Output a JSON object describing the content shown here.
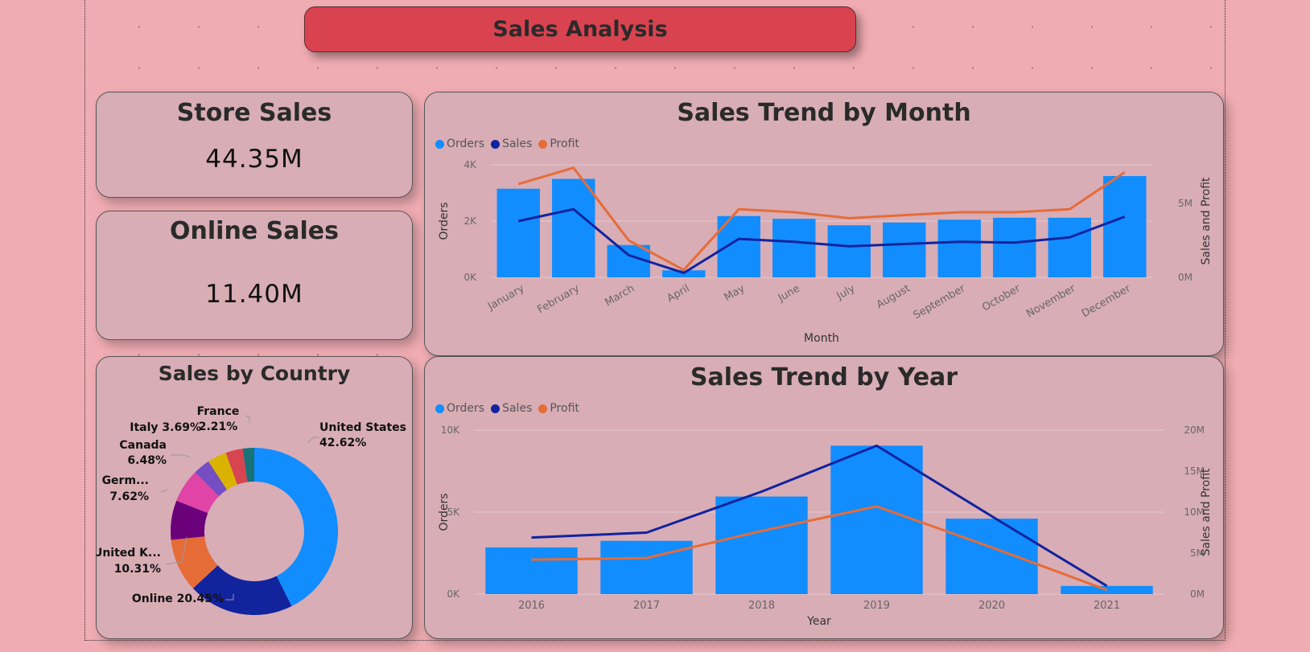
{
  "header": {
    "title": "Sales Analysis"
  },
  "kpis": {
    "store": {
      "title": "Store Sales",
      "value": "44.35M"
    },
    "online": {
      "title": "Online Sales",
      "value": "11.40M"
    }
  },
  "colors": {
    "orders": "#118dff",
    "sales": "#12239e",
    "profit": "#e66c37"
  },
  "legend": [
    "Orders",
    "Sales",
    "Profit"
  ],
  "chart_data": [
    {
      "id": "month",
      "type": "bar",
      "title": "Sales Trend by Month",
      "xlabel": "Month",
      "ylabel": "Orders",
      "y2label": "Sales and Profit",
      "categories": [
        "January",
        "February",
        "March",
        "April",
        "May",
        "June",
        "July",
        "August",
        "September",
        "October",
        "November",
        "December"
      ],
      "ylim": [
        0,
        4000
      ],
      "yticks": [
        0,
        2000,
        4000
      ],
      "ytick_labels": [
        "0K",
        "2K",
        "4K"
      ],
      "y2lim": [
        0,
        7600000
      ],
      "y2ticks": [
        0,
        5000000
      ],
      "y2tick_labels": [
        "0M",
        "5M"
      ],
      "series": [
        {
          "name": "Orders",
          "kind": "bar",
          "axis": "y",
          "values": [
            3150,
            3500,
            1150,
            250,
            2180,
            2080,
            1850,
            1950,
            2050,
            2120,
            2120,
            3600
          ]
        },
        {
          "name": "Sales",
          "kind": "line",
          "axis": "y2",
          "values": [
            3800000,
            4600000,
            1500000,
            300000,
            2600000,
            2400000,
            2100000,
            2250000,
            2400000,
            2350000,
            2700000,
            4100000
          ]
        },
        {
          "name": "Profit",
          "kind": "line",
          "axis": "y2",
          "values": [
            6300000,
            7400000,
            2500000,
            500000,
            4600000,
            4400000,
            4000000,
            4200000,
            4400000,
            4400000,
            4600000,
            7100000
          ]
        }
      ]
    },
    {
      "id": "year",
      "type": "bar",
      "title": "Sales Trend by Year",
      "xlabel": "Year",
      "ylabel": "Orders",
      "y2label": "Sales and Profit",
      "categories": [
        "2016",
        "2017",
        "2018",
        "2019",
        "2020",
        "2021"
      ],
      "ylim": [
        0,
        10000
      ],
      "yticks": [
        0,
        5000,
        10000
      ],
      "ytick_labels": [
        "0K",
        "5K",
        "10K"
      ],
      "y2lim": [
        0,
        20000000
      ],
      "y2ticks": [
        0,
        5000000,
        10000000,
        15000000,
        20000000
      ],
      "y2tick_labels": [
        "0M",
        "5M",
        "10M",
        "15M",
        "20M"
      ],
      "series": [
        {
          "name": "Orders",
          "kind": "bar",
          "axis": "y",
          "values": [
            2850,
            3250,
            5950,
            9050,
            4600,
            500
          ]
        },
        {
          "name": "Sales",
          "kind": "line",
          "axis": "y2",
          "values": [
            6900000,
            7500000,
            12500000,
            18100000,
            9500000,
            1000000
          ]
        },
        {
          "name": "Profit",
          "kind": "line",
          "axis": "y2",
          "values": [
            4200000,
            4400000,
            7700000,
            10700000,
            5700000,
            500000
          ]
        }
      ]
    },
    {
      "id": "country",
      "type": "pie",
      "title": "Sales by Country",
      "slices": [
        {
          "label": "United States",
          "pct_label": "42.62%",
          "value": 42.62,
          "color": "#118dff"
        },
        {
          "label": "Online",
          "pct_label": "20.45%",
          "value": 20.45,
          "color": "#12239e"
        },
        {
          "label": "United K...",
          "pct_label": "10.31%",
          "value": 10.31,
          "color": "#e66c37"
        },
        {
          "label": "Germ...",
          "pct_label": "7.62%",
          "value": 7.62,
          "color": "#6b007b"
        },
        {
          "label": "Canada",
          "pct_label": "6.48%",
          "value": 6.48,
          "color": "#e044a7"
        },
        {
          "label": "",
          "pct_label": "",
          "value": 3.3,
          "color": "#744ec2"
        },
        {
          "label": "Italy",
          "pct_label": "3.69%",
          "value": 3.69,
          "color": "#d9b300"
        },
        {
          "label": "",
          "pct_label": "",
          "value": 3.32,
          "color": "#d64550"
        },
        {
          "label": "France",
          "pct_label": "2.21%",
          "value": 2.21,
          "color": "#197278"
        }
      ]
    }
  ]
}
